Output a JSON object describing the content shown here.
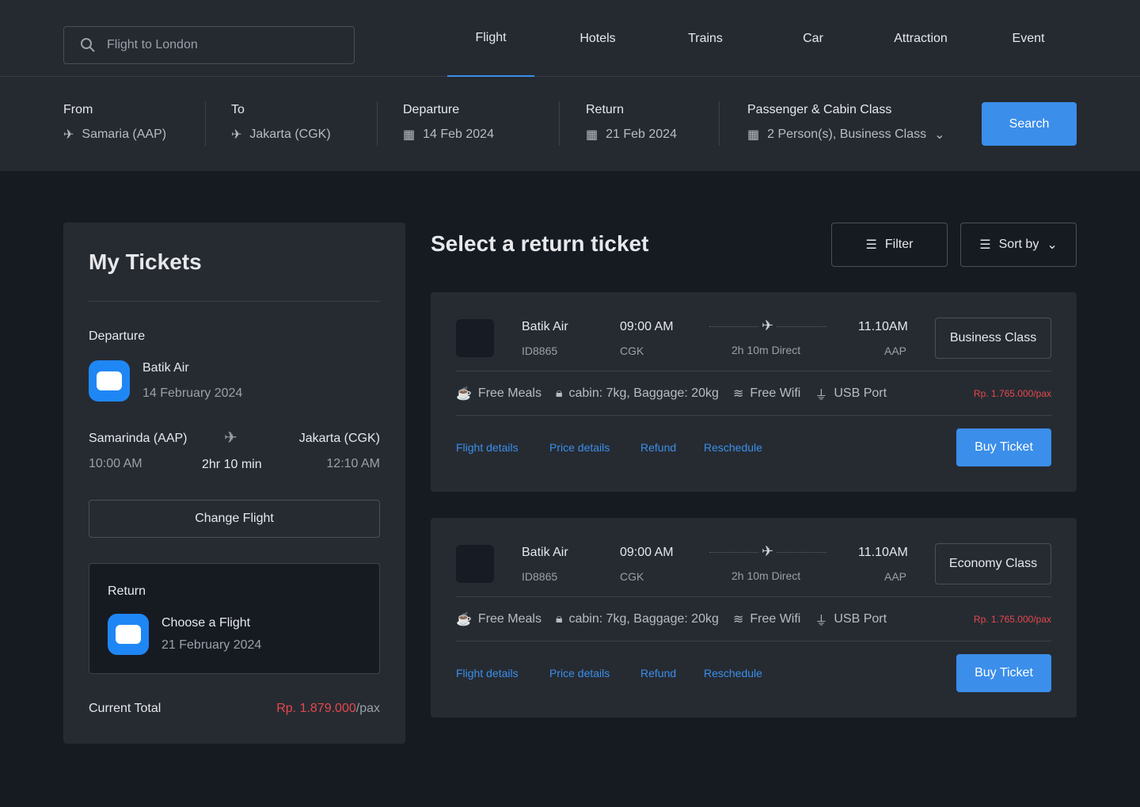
{
  "search": {
    "placeholder": "Flight to London"
  },
  "nav": [
    "Flight",
    "Hotels",
    "Trains",
    "Car",
    "Attraction",
    "Event"
  ],
  "form": {
    "from_label": "From",
    "from": "Samaria (AAP)",
    "to_label": "To",
    "to": "Jakarta (CGK)",
    "dep_label": "Departure",
    "dep": "14 Feb 2024",
    "ret_label": "Return",
    "ret": "21 Feb 2024",
    "pax_label": "Passenger & Cabin Class",
    "pax": "2 Person(s), Business Class",
    "search": "Search"
  },
  "tickets": {
    "title": "My Tickets",
    "departure": "Departure",
    "airline": "Batik Air",
    "date": "14 February 2024",
    "from": "Samarinda (AAP)",
    "to": "Jakarta (CGK)",
    "dep_time": "10:00 AM",
    "duration": "2hr 10 min",
    "arr_time": "12:10 AM",
    "change": "Change Flight",
    "return": "Return",
    "choose": "Choose a Flight",
    "ret_date": "21 February 2024",
    "total_label": "Current Total",
    "total": "Rp. 1.879.000",
    "per": "/pax"
  },
  "main": {
    "title": "Select a return ticket",
    "filter": "Filter",
    "sort": "Sort by"
  },
  "flights": [
    {
      "airline": "Batik Air",
      "code": "ID8865",
      "dep": "09:00 AM",
      "dep_ap": "CGK",
      "dur": "2h 10m Direct",
      "arr": "11.10AM",
      "arr_ap": "AAP",
      "cls": "Business Class",
      "meals": "Free Meals",
      "bag": "cabin: 7kg, Baggage: 20kg",
      "wifi": "Free Wifi",
      "usb": "USB Port",
      "price": "Rp. 1.765.000/pax",
      "l1": "Flight details",
      "l2": "Price details",
      "l3": "Refund",
      "l4": "Reschedule",
      "buy": "Buy Ticket"
    },
    {
      "airline": "Batik Air",
      "code": "ID8865",
      "dep": "09:00 AM",
      "dep_ap": "CGK",
      "dur": "2h 10m Direct",
      "arr": "11.10AM",
      "arr_ap": "AAP",
      "cls": "Economy Class",
      "meals": "Free Meals",
      "bag": "cabin: 7kg, Baggage: 20kg",
      "wifi": "Free Wifi",
      "usb": "USB Port",
      "price": "Rp. 1.765.000/pax",
      "l1": "Flight details",
      "l2": "Price details",
      "l3": "Refund",
      "l4": "Reschedule",
      "buy": "Buy Ticket"
    }
  ]
}
